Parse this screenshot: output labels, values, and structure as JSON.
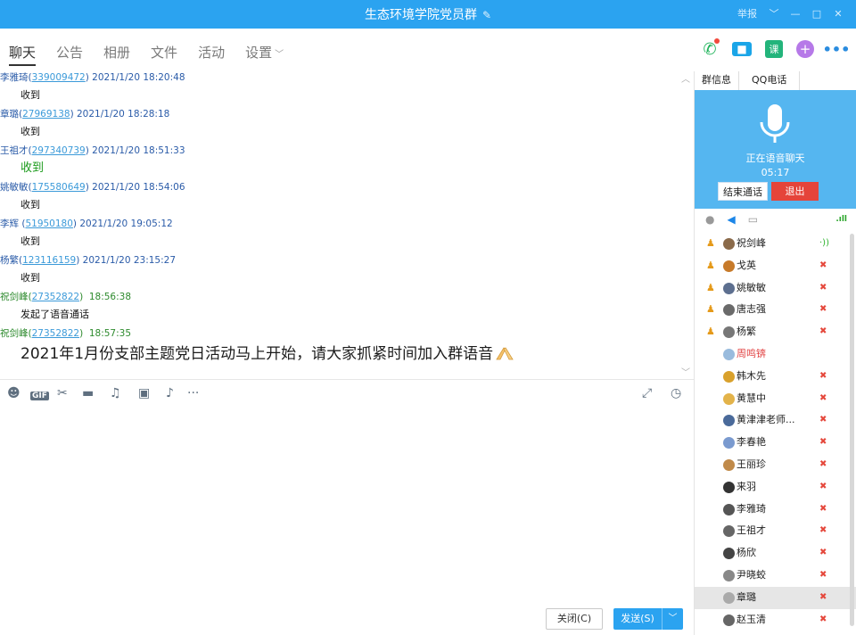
{
  "window": {
    "title": "生态环境学院党员群",
    "controls": {
      "report": "举报",
      "dropdown": "﹀",
      "minimize": "—",
      "maximize": "□",
      "close": "✕"
    },
    "edit_icon": "pencil-icon"
  },
  "tabs": [
    {
      "label": "聊天",
      "active": true
    },
    {
      "label": "公告",
      "active": false
    },
    {
      "label": "相册",
      "active": false
    },
    {
      "label": "文件",
      "active": false
    },
    {
      "label": "活动",
      "active": false
    },
    {
      "label": "设置",
      "active": false
    }
  ],
  "toolbar_icons": [
    "phone-call-icon",
    "video-call-icon",
    "course-icon",
    "add-app-icon",
    "more-icon"
  ],
  "course_icon_text": "课",
  "messages": [
    {
      "sender": "李雅琦",
      "qq": "339009472",
      "time": "2021/1/20 18:20:48",
      "text": "收到",
      "style": "normal"
    },
    {
      "sender": "章璐",
      "qq": "27969138",
      "time": "2021/1/20 18:28:18",
      "text": "收到",
      "style": "normal"
    },
    {
      "sender": "王祖才",
      "qq": "297340739",
      "time": "2021/1/20 18:51:33",
      "text": "收到",
      "style": "big"
    },
    {
      "sender": "姚敏敏",
      "qq": "175580649",
      "time": "2021/1/20 18:54:06",
      "text": "收到",
      "style": "normal"
    },
    {
      "sender": "李辉 ",
      "qq": "51950180",
      "time": "2021/1/20 19:05:12",
      "text": "收到",
      "style": "normal"
    },
    {
      "sender": "杨繁",
      "qq": "123116159",
      "time": "2021/1/20 23:15:27",
      "text": "收到",
      "style": "normal"
    },
    {
      "sender": "祝剑峰",
      "qq": "27352822",
      "time": "18:56:38",
      "text": "发起了语音通话",
      "style": "normal"
    },
    {
      "sender": "祝剑峰",
      "qq": "27352822",
      "time": "18:57:35",
      "text": "2021年1月份支部主题党日活动马上开始，请大家抓紧时间加入群语音",
      "style": "huge"
    }
  ],
  "input_toolbar": [
    "emoji-icon",
    "gif-icon",
    "screenshot-scissors-icon",
    "folder-icon",
    "music-icon",
    "image-icon",
    "bell-icon",
    "more-dots-icon"
  ],
  "gif_text": "GIF",
  "input_toolbar_right": [
    "expand-icon",
    "history-clock-icon"
  ],
  "buttons": {
    "close": "关闭(C)",
    "send": "发送(S)",
    "send_dropdown": "﹀"
  },
  "right_panel": {
    "tabs": [
      "群信息",
      "QQ电话"
    ],
    "voice": {
      "status": "正在语音聊天",
      "duration": "05:17",
      "end_button": "结束通话",
      "quit_button": "退出"
    },
    "controls": [
      "microphone-icon",
      "speaker-icon",
      "camera-icon",
      "signal-icon"
    ],
    "members": [
      {
        "name": "祝剑峰",
        "admin": true,
        "status": "speaking"
      },
      {
        "name": "戈英",
        "admin": true,
        "status": "muted"
      },
      {
        "name": "姚敏敏",
        "admin": true,
        "status": "muted"
      },
      {
        "name": "唐志强",
        "admin": true,
        "status": "muted"
      },
      {
        "name": "杨繁",
        "admin": true,
        "status": "muted"
      },
      {
        "name": "周鸣锛",
        "admin": false,
        "status": "none",
        "highlight": true
      },
      {
        "name": "韩木先",
        "admin": false,
        "status": "muted"
      },
      {
        "name": "黄慧中",
        "admin": false,
        "status": "muted"
      },
      {
        "name": "黄津津老师...",
        "admin": false,
        "status": "muted"
      },
      {
        "name": "李春艳",
        "admin": false,
        "status": "muted"
      },
      {
        "name": "王丽珍",
        "admin": false,
        "status": "muted"
      },
      {
        "name": "来羽",
        "admin": false,
        "status": "muted"
      },
      {
        "name": "李雅琦",
        "admin": false,
        "status": "muted"
      },
      {
        "name": "王祖才",
        "admin": false,
        "status": "muted"
      },
      {
        "name": "杨欣",
        "admin": false,
        "status": "muted"
      },
      {
        "name": "尹晓蛟",
        "admin": false,
        "status": "muted"
      },
      {
        "name": "章璐",
        "admin": false,
        "status": "muted",
        "selected": true
      },
      {
        "name": "赵玉清",
        "admin": false,
        "status": "muted"
      }
    ]
  },
  "colors": {
    "accent": "#2ba3f0",
    "voice_panel": "#55b6f0",
    "quit": "#e5443a",
    "speaking": "#2db32d",
    "muted": "#e5483c"
  }
}
